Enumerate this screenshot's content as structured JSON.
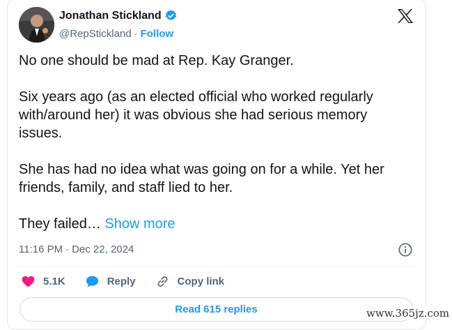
{
  "author": {
    "name": "Jonathan Stickland",
    "handle": "@RepStickland",
    "separator": "·",
    "follow_label": "Follow",
    "verified_color": "#1d9bf0"
  },
  "post": {
    "paragraphs": [
      "No one should be mad at Rep. Kay Granger.",
      "Six years ago (as an elected official who worked regularly with/around her) it was obvious she had serious memory issues.",
      "She has had no idea what was going on for a while. Yet her friends, family, and staff lied to her."
    ],
    "truncated_text": "They failed…",
    "show_more_label": "Show more",
    "timestamp_time": "11:16 PM",
    "timestamp_date": "Dec 22, 2024"
  },
  "actions": {
    "likes_count": "5.1K",
    "reply_label": "Reply",
    "copy_link_label": "Copy link"
  },
  "replies_button": "Read 615 replies",
  "watermark": "www.365jz.com",
  "colors": {
    "accent": "#1d9bf0",
    "like": "#f91880",
    "text": "#0f1419",
    "muted": "#536471"
  },
  "icons": [
    "verified-badge-icon",
    "x-logo-icon",
    "info-icon",
    "heart-icon",
    "reply-bubble-icon",
    "link-icon"
  ]
}
